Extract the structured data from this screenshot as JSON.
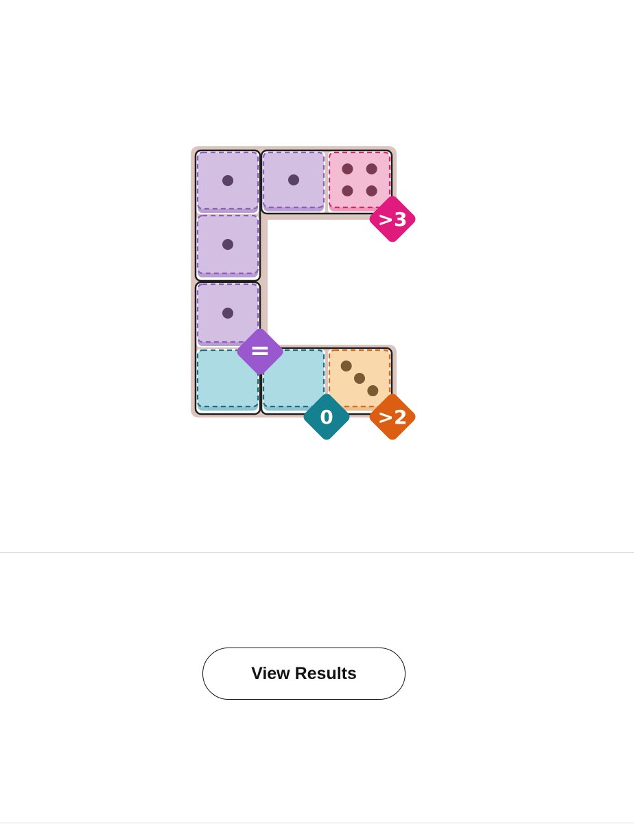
{
  "game": {
    "colors": {
      "board": "#dcc5bf",
      "cell": "#ffffff",
      "pip": "#5a4a66"
    },
    "regions": [
      {
        "id": "purple",
        "fill": "#d2bfe2",
        "shade": "#b89fd0",
        "border": "#8e5bbf",
        "pip": "#5a4266",
        "badge": {
          "label": "=",
          "color": "#9a58cf"
        }
      },
      {
        "id": "pink",
        "fill": "#f4bcd2",
        "shade": "#e79bb8",
        "border": "#d8266e",
        "pip": "#7a3a52",
        "badge": {
          "label": ">3",
          "color": "#e01b7d"
        }
      },
      {
        "id": "teal",
        "fill": "#acdbe4",
        "shade": "#8cc5d1",
        "border": "#1b6e7a",
        "pip": "#2f5a60",
        "badge": {
          "label": "0",
          "color": "#148090"
        }
      },
      {
        "id": "orange",
        "fill": "#f9d9ac",
        "shade": "#ecc08a",
        "border": "#d96a1a",
        "pip": "#7a5a32",
        "badge": {
          "label": ">2",
          "color": "#dc5e12"
        }
      }
    ],
    "dice": [
      {
        "region": "purple",
        "value": 1
      },
      {
        "region": "purple",
        "value": 1
      },
      {
        "region": "purple",
        "value": 1
      },
      {
        "region": "purple",
        "value": 1
      },
      {
        "region": "pink",
        "value": 4
      },
      {
        "region": "teal",
        "value": 0
      },
      {
        "region": "teal",
        "value": 0
      },
      {
        "region": "orange",
        "value": 3
      }
    ]
  },
  "footer": {
    "results_label": "View Results"
  }
}
